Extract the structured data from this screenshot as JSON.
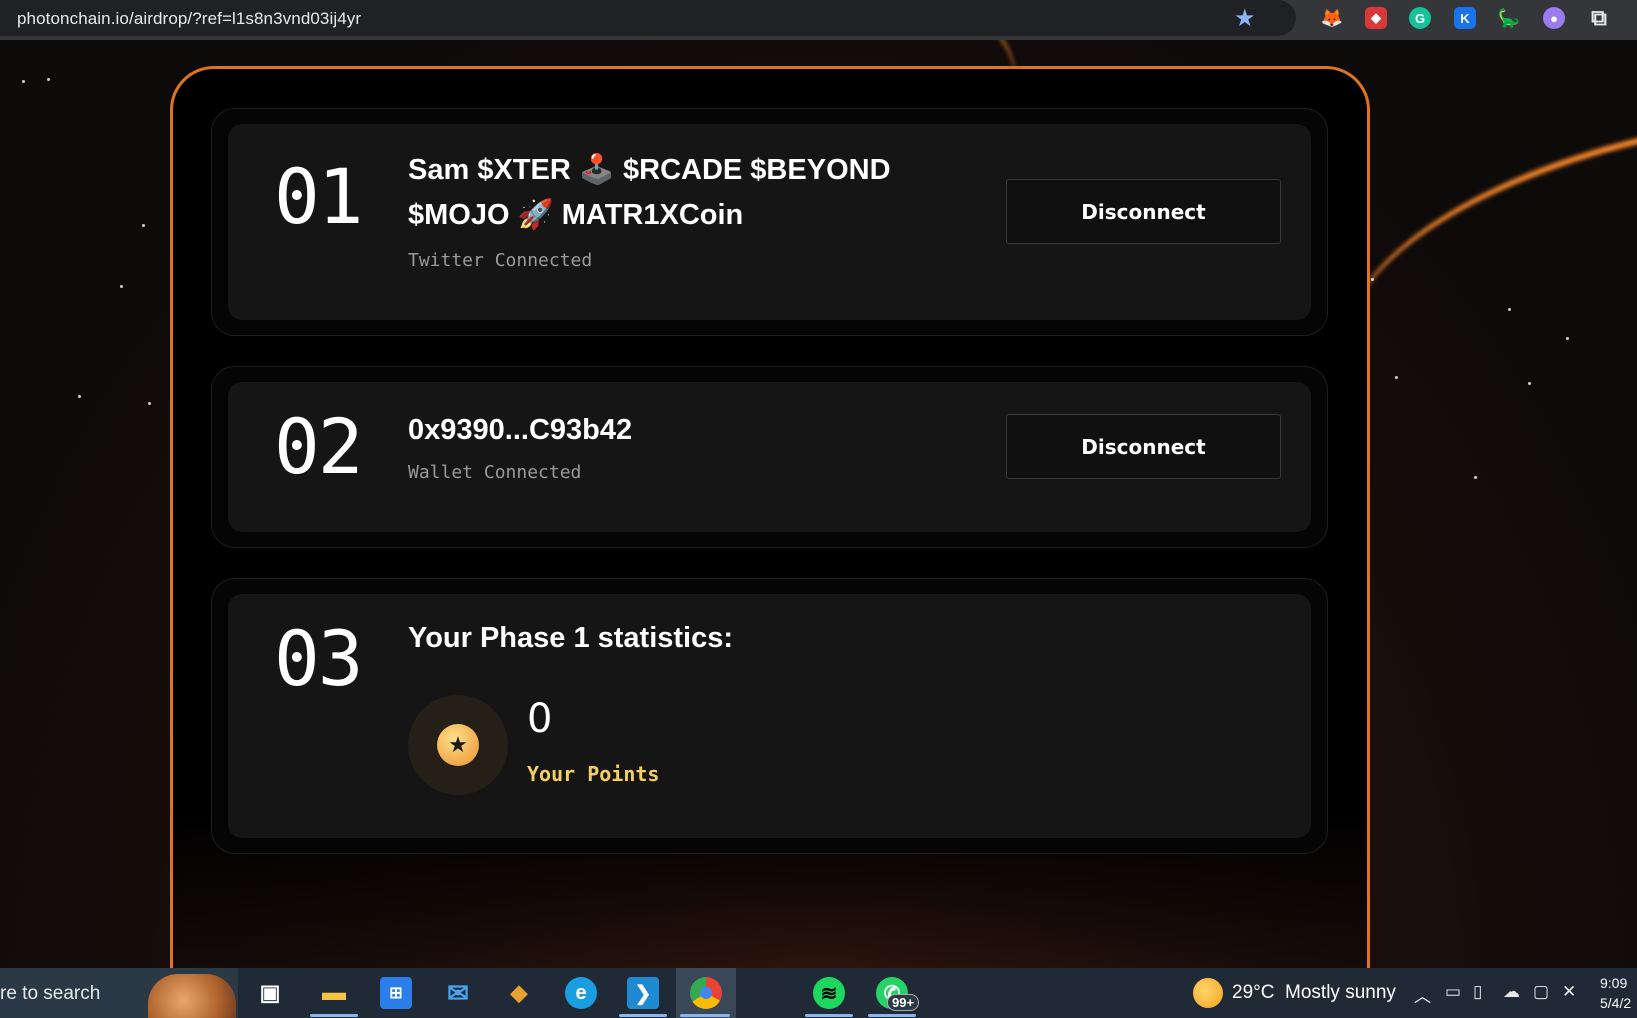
{
  "browser": {
    "url": "photonchain.io/airdrop/?ref=l1s8n3vnd03ij4yr",
    "bookmark_icon": "star-icon",
    "extensions": [
      {
        "name": "metamask-extension-icon",
        "glyph": "🦊",
        "color": "#e2761b"
      },
      {
        "name": "red-extension-icon",
        "glyph": "◆",
        "color": "#d93838"
      },
      {
        "name": "grammarly-extension-icon",
        "glyph": "G",
        "color": "#15c39a"
      },
      {
        "name": "k-extension-icon",
        "glyph": "K",
        "color": "#1a73e8"
      },
      {
        "name": "green-extension-icon",
        "glyph": "🦕",
        "color": "#3ba55c"
      },
      {
        "name": "purple-extension-icon",
        "glyph": "👻",
        "color": "#9b7cf0"
      },
      {
        "name": "extensions-puzzle-icon",
        "glyph": "⧉",
        "color": "#35363a"
      }
    ]
  },
  "steps": [
    {
      "number": "01",
      "title_line1": "Sam $XTER 🕹️ $RCADE $BEYOND",
      "title_line2": "$MOJO 🚀 MATR1XCoin",
      "status": "Twitter Connected",
      "button": "Disconnect"
    },
    {
      "number": "02",
      "title": "0x9390...C93b42",
      "status": "Wallet Connected",
      "button": "Disconnect"
    },
    {
      "number": "03",
      "title": "Your Phase 1 statistics:",
      "points_value": "0",
      "points_label": "Your Points"
    }
  ],
  "taskbar": {
    "search_text": "re to search",
    "weather_temp": "29°C",
    "weather_text": "Mostly sunny",
    "time": "9:09",
    "date": "5/4/2",
    "whatsapp_badge": "99+"
  },
  "colors": {
    "accent_orange": "#e0731f",
    "card_bg": "#151515",
    "points_yellow": "#f5d060"
  }
}
